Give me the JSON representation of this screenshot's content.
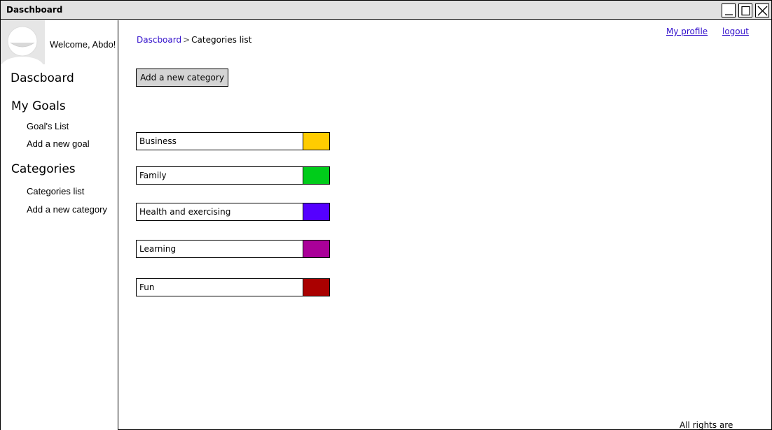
{
  "window": {
    "title": "Daschboard"
  },
  "header": {
    "my_profile": "My profile",
    "logout": "logout"
  },
  "sidebar": {
    "welcome": "Welcome, Abdo!",
    "dashboard": "Dascboard",
    "goals_heading": "My Goals",
    "goals_items": [
      "Goal's List",
      "Add a new goal"
    ],
    "categories_heading": "Categories",
    "categories_items": [
      "Categories list",
      "Add a new category"
    ]
  },
  "breadcrumb": {
    "home": "Dascboard",
    "separator": ">",
    "current": "Categories list"
  },
  "main": {
    "add_button": "Add a new category",
    "categories": [
      {
        "name": "Business",
        "color": "#ffcc00"
      },
      {
        "name": "Family",
        "color": "#00cc1a"
      },
      {
        "name": "Health and exercising",
        "color": "#5500ff"
      },
      {
        "name": "Learning",
        "color": "#aa0099"
      },
      {
        "name": "Fun",
        "color": "#aa0000"
      }
    ]
  },
  "footer": {
    "text": "All rights are reserved"
  }
}
